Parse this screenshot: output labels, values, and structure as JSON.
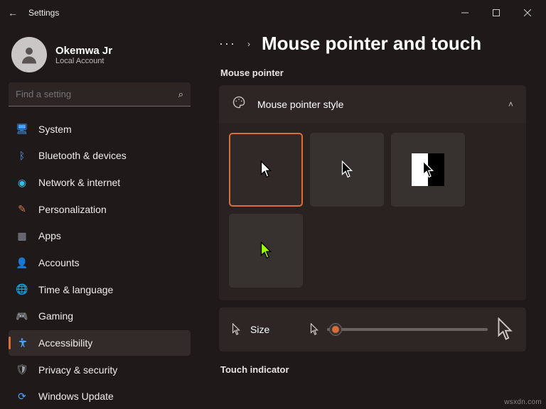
{
  "window": {
    "title": "Settings"
  },
  "user": {
    "name": "Okemwa Jr",
    "sub": "Local Account"
  },
  "search": {
    "placeholder": "Find a setting"
  },
  "nav": {
    "items": [
      {
        "label": "System",
        "icon": "🖥",
        "color": "#4aa3ff"
      },
      {
        "label": "Bluetooth & devices",
        "icon": "ᛒ",
        "color": "#4aa3ff"
      },
      {
        "label": "Network & internet",
        "icon": "◉",
        "color": "#2fc1e8"
      },
      {
        "label": "Personalization",
        "icon": "✎",
        "color": "#d07a4a"
      },
      {
        "label": "Apps",
        "icon": "▦",
        "color": "#8f93a0"
      },
      {
        "label": "Accounts",
        "icon": "👤",
        "color": "#e2a04a"
      },
      {
        "label": "Time & language",
        "icon": "🌐",
        "color": "#4aa3ff"
      },
      {
        "label": "Gaming",
        "icon": "🎮",
        "color": "#9aa0a6"
      },
      {
        "label": "Accessibility",
        "icon": "�вд",
        "color": "#4aa3ff",
        "active": true
      },
      {
        "label": "Privacy & security",
        "icon": "🛡",
        "color": "#9aa0a6"
      },
      {
        "label": "Windows Update",
        "icon": "⟳",
        "color": "#4aa3ff"
      }
    ]
  },
  "breadcrumb": {
    "dots": "···",
    "chevron": "›",
    "title": "Mouse pointer and touch"
  },
  "sections": {
    "pointer": "Mouse pointer",
    "touch": "Touch indicator"
  },
  "styleCard": {
    "label": "Mouse pointer style",
    "expand": "˄"
  },
  "styleOptions": [
    "white",
    "black",
    "inverted",
    "custom"
  ],
  "sizeCard": {
    "label": "Size"
  },
  "watermark": "wsxdn.com"
}
